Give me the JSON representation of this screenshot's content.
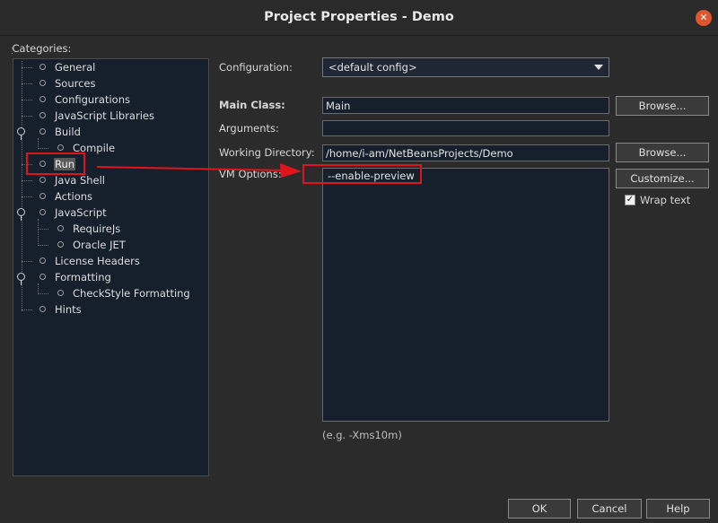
{
  "window": {
    "title": "Project Properties - Demo"
  },
  "categories": {
    "label": "Categories:",
    "items": [
      {
        "label": "General"
      },
      {
        "label": "Sources"
      },
      {
        "label": "Configurations"
      },
      {
        "label": "JavaScript Libraries"
      },
      {
        "label": "Build"
      },
      {
        "label": "Compile"
      },
      {
        "label": "Run"
      },
      {
        "label": "Java Shell"
      },
      {
        "label": "Actions"
      },
      {
        "label": "JavaScript"
      },
      {
        "label": "RequireJs"
      },
      {
        "label": "Oracle JET"
      },
      {
        "label": "License Headers"
      },
      {
        "label": "Formatting"
      },
      {
        "label": "CheckStyle Formatting"
      },
      {
        "label": "Hints"
      }
    ],
    "selected": "Run"
  },
  "form": {
    "configuration_label": "Configuration:",
    "configuration_value": "<default config>",
    "main_class_label": "Main Class:",
    "main_class_value": "Main",
    "arguments_label": "Arguments:",
    "arguments_value": "",
    "working_dir_label": "Working Directory:",
    "working_dir_value": "/home/i-am/NetBeansProjects/Demo",
    "vm_options_label": "VM Options:",
    "vm_options_value": "--enable-preview",
    "vm_hint": "(e.g. -Xms10m)",
    "browse_label": "Browse...",
    "customize_label": "Customize...",
    "wrap_text_label": "Wrap text",
    "wrap_text_checked": true
  },
  "footer": {
    "ok": "OK",
    "cancel": "Cancel",
    "help": "Help"
  },
  "colors": {
    "annotation": "#e0141c",
    "close_button": "#e0562c"
  }
}
